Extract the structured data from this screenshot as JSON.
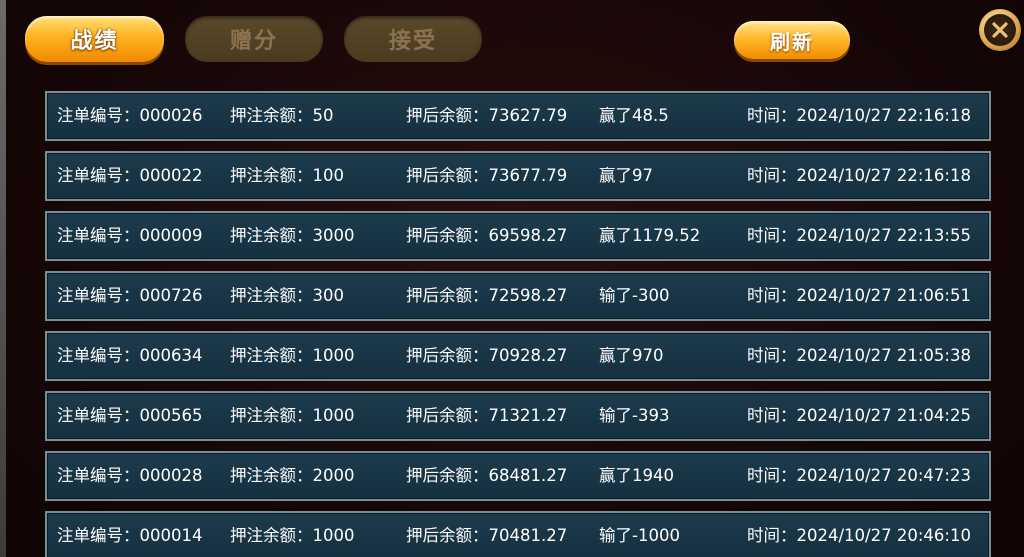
{
  "tabs": {
    "record_label": "战绩",
    "gift_label": "赠分",
    "accept_label": "接受"
  },
  "toolbar": {
    "refresh_label": "刷新"
  },
  "close": {
    "icon": "close-icon"
  },
  "colors": {
    "accent_orange": "#ffb21f",
    "row_bg": "#1c3b4d",
    "row_border": "#7a8c96",
    "inactive_tab": "#4a3a1f"
  },
  "records": [
    {
      "order": "注单编号：000026",
      "bet": "押注余额：50",
      "after": "押后余额：73627.79",
      "result": "赢了48.5",
      "time": "时间：2024/10/27 22:16:18"
    },
    {
      "order": "注单编号：000022",
      "bet": "押注余额：100",
      "after": "押后余额：73677.79",
      "result": "赢了97",
      "time": "时间：2024/10/27 22:16:18"
    },
    {
      "order": "注单编号：000009",
      "bet": "押注余额：3000",
      "after": "押后余额：69598.27",
      "result": "赢了1179.52",
      "time": "时间：2024/10/27 22:13:55"
    },
    {
      "order": "注单编号：000726",
      "bet": "押注余额：300",
      "after": "押后余额：72598.27",
      "result": "输了-300",
      "time": "时间：2024/10/27 21:06:51"
    },
    {
      "order": "注单编号：000634",
      "bet": "押注余额：1000",
      "after": "押后余额：70928.27",
      "result": "赢了970",
      "time": "时间：2024/10/27 21:05:38"
    },
    {
      "order": "注单编号：000565",
      "bet": "押注余额：1000",
      "after": "押后余额：71321.27",
      "result": "输了-393",
      "time": "时间：2024/10/27 21:04:25"
    },
    {
      "order": "注单编号：000028",
      "bet": "押注余额：2000",
      "after": "押后余额：68481.27",
      "result": "赢了1940",
      "time": "时间：2024/10/27 20:47:23"
    },
    {
      "order": "注单编号：000014",
      "bet": "押注余额：1000",
      "after": "押后余额：70481.27",
      "result": "输了-1000",
      "time": "时间：2024/10/27 20:46:10"
    }
  ]
}
